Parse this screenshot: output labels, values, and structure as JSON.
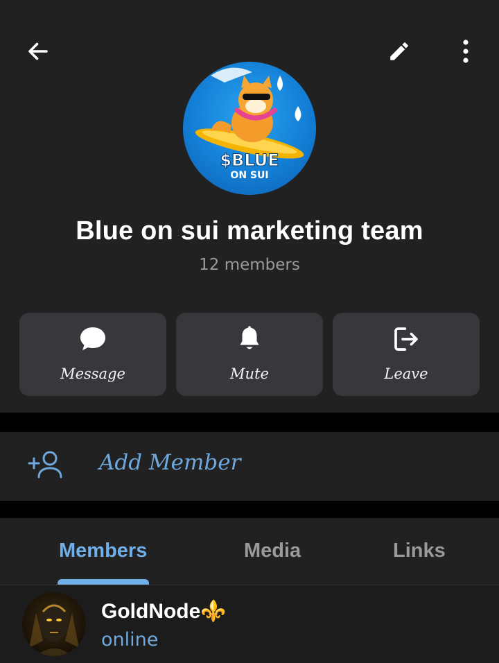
{
  "group": {
    "title": "Blue on sui marketing team",
    "members_count": "12 members",
    "avatar_text_top": "$BLUE",
    "avatar_text_bottom": "ON SUI"
  },
  "header_icons": [
    "back-arrow-icon",
    "pencil-icon",
    "more-vertical-icon"
  ],
  "actions": [
    {
      "label": "Message",
      "icon": "chat-bubble-icon"
    },
    {
      "label": "Mute",
      "icon": "bell-icon"
    },
    {
      "label": "Leave",
      "icon": "logout-icon"
    }
  ],
  "add_member": {
    "label": "Add Member",
    "icon": "add-person-icon"
  },
  "tabs": [
    {
      "label": "Members",
      "active": true
    },
    {
      "label": "Media",
      "active": false
    },
    {
      "label": "Links",
      "active": false
    }
  ],
  "members": [
    {
      "name": "GoldNode⚜️",
      "status": "online"
    }
  ],
  "colors": {
    "background": "#212121",
    "card": "#38383c",
    "accent": "#6fa8dc",
    "inactive_tab": "#9a9a9a"
  }
}
